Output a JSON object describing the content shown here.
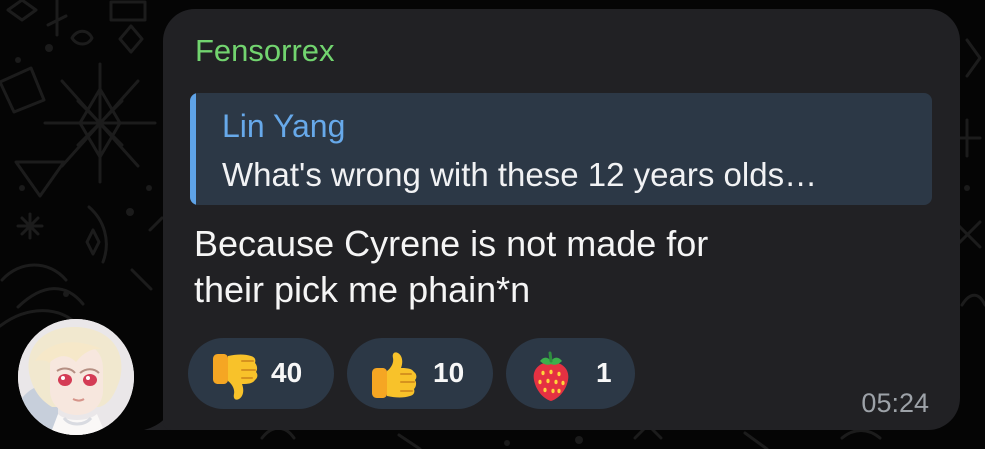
{
  "message": {
    "sender_name": "Fensorrex",
    "reply": {
      "author": "Lin Yang",
      "text": "What's wrong with these 12 years olds…"
    },
    "text_line_1": "Because Cyrene is not made for",
    "text_line_2": "their pick me phain*n",
    "time": "05:24",
    "reactions": [
      {
        "icon": "thumbs-down-icon",
        "count": "40"
      },
      {
        "icon": "thumbs-up-icon",
        "count": "10"
      },
      {
        "icon": "strawberry-icon",
        "count": "1"
      }
    ]
  },
  "colors": {
    "sender_name": "#72d46f",
    "reply_accent": "#5fa3e7",
    "bubble": "#212124",
    "reaction_bg": "#2c3846"
  }
}
